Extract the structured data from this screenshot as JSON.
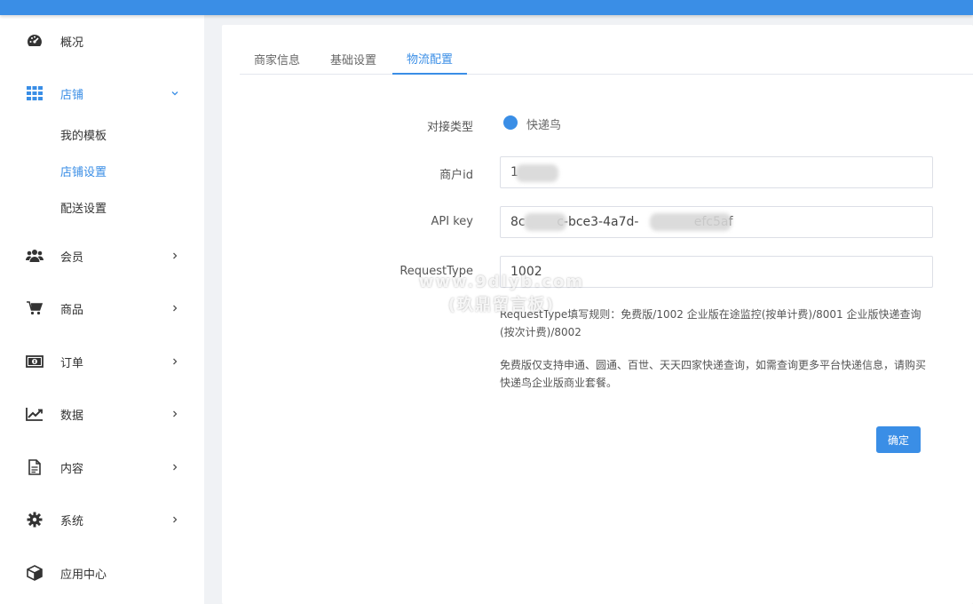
{
  "sidebar": {
    "items": [
      {
        "label": "概况"
      },
      {
        "label": "店铺",
        "sub": [
          {
            "label": "我的模板"
          },
          {
            "label": "店铺设置"
          },
          {
            "label": "配送设置"
          }
        ]
      },
      {
        "label": "会员"
      },
      {
        "label": "商品"
      },
      {
        "label": "订单"
      },
      {
        "label": "数据"
      },
      {
        "label": "内容"
      },
      {
        "label": "系统"
      },
      {
        "label": "应用中心"
      }
    ]
  },
  "tabs": [
    {
      "label": "商家信息"
    },
    {
      "label": "基础设置"
    },
    {
      "label": "物流配置"
    }
  ],
  "form": {
    "type_label": "对接类型",
    "type_option": "快递鸟",
    "merchant_label": "商户id",
    "merchant_value": "1",
    "apikey_label": "API key",
    "apikey_value": "8c        c-bce3-4a7d-              efc5af",
    "reqtype_label": "RequestType",
    "reqtype_value": "1002",
    "help1": "RequestType填写规则：免费版/1002 企业版在途监控(按单计费)/8001 企业版快递查询(按次计费)/8002",
    "help2": "免费版仅支持申通、圆通、百世、天天四家快递查询，如需查询更多平台快递信息，请购买快递鸟企业版商业套餐。",
    "submit_label": "确定"
  },
  "watermark": {
    "line1": "www.9dlyb.com",
    "line2": "(玖鼎留言板)"
  },
  "colors": {
    "accent": "#3a8ee6",
    "topbar": "#3a8ee6"
  }
}
